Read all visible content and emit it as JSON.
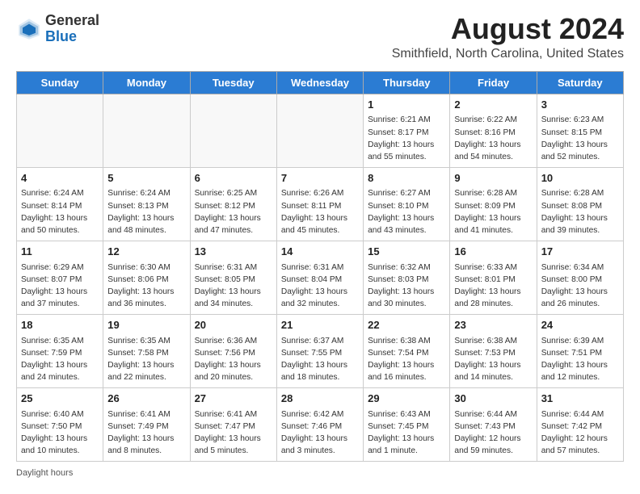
{
  "logo": {
    "general": "General",
    "blue": "Blue"
  },
  "title": "August 2024",
  "location": "Smithfield, North Carolina, United States",
  "headers": [
    "Sunday",
    "Monday",
    "Tuesday",
    "Wednesday",
    "Thursday",
    "Friday",
    "Saturday"
  ],
  "footer": "Daylight hours",
  "weeks": [
    [
      {
        "day": "",
        "sunrise": "",
        "sunset": "",
        "daylight": ""
      },
      {
        "day": "",
        "sunrise": "",
        "sunset": "",
        "daylight": ""
      },
      {
        "day": "",
        "sunrise": "",
        "sunset": "",
        "daylight": ""
      },
      {
        "day": "",
        "sunrise": "",
        "sunset": "",
        "daylight": ""
      },
      {
        "day": "1",
        "sunrise": "Sunrise: 6:21 AM",
        "sunset": "Sunset: 8:17 PM",
        "daylight": "Daylight: 13 hours and 55 minutes."
      },
      {
        "day": "2",
        "sunrise": "Sunrise: 6:22 AM",
        "sunset": "Sunset: 8:16 PM",
        "daylight": "Daylight: 13 hours and 54 minutes."
      },
      {
        "day": "3",
        "sunrise": "Sunrise: 6:23 AM",
        "sunset": "Sunset: 8:15 PM",
        "daylight": "Daylight: 13 hours and 52 minutes."
      }
    ],
    [
      {
        "day": "4",
        "sunrise": "Sunrise: 6:24 AM",
        "sunset": "Sunset: 8:14 PM",
        "daylight": "Daylight: 13 hours and 50 minutes."
      },
      {
        "day": "5",
        "sunrise": "Sunrise: 6:24 AM",
        "sunset": "Sunset: 8:13 PM",
        "daylight": "Daylight: 13 hours and 48 minutes."
      },
      {
        "day": "6",
        "sunrise": "Sunrise: 6:25 AM",
        "sunset": "Sunset: 8:12 PM",
        "daylight": "Daylight: 13 hours and 47 minutes."
      },
      {
        "day": "7",
        "sunrise": "Sunrise: 6:26 AM",
        "sunset": "Sunset: 8:11 PM",
        "daylight": "Daylight: 13 hours and 45 minutes."
      },
      {
        "day": "8",
        "sunrise": "Sunrise: 6:27 AM",
        "sunset": "Sunset: 8:10 PM",
        "daylight": "Daylight: 13 hours and 43 minutes."
      },
      {
        "day": "9",
        "sunrise": "Sunrise: 6:28 AM",
        "sunset": "Sunset: 8:09 PM",
        "daylight": "Daylight: 13 hours and 41 minutes."
      },
      {
        "day": "10",
        "sunrise": "Sunrise: 6:28 AM",
        "sunset": "Sunset: 8:08 PM",
        "daylight": "Daylight: 13 hours and 39 minutes."
      }
    ],
    [
      {
        "day": "11",
        "sunrise": "Sunrise: 6:29 AM",
        "sunset": "Sunset: 8:07 PM",
        "daylight": "Daylight: 13 hours and 37 minutes."
      },
      {
        "day": "12",
        "sunrise": "Sunrise: 6:30 AM",
        "sunset": "Sunset: 8:06 PM",
        "daylight": "Daylight: 13 hours and 36 minutes."
      },
      {
        "day": "13",
        "sunrise": "Sunrise: 6:31 AM",
        "sunset": "Sunset: 8:05 PM",
        "daylight": "Daylight: 13 hours and 34 minutes."
      },
      {
        "day": "14",
        "sunrise": "Sunrise: 6:31 AM",
        "sunset": "Sunset: 8:04 PM",
        "daylight": "Daylight: 13 hours and 32 minutes."
      },
      {
        "day": "15",
        "sunrise": "Sunrise: 6:32 AM",
        "sunset": "Sunset: 8:03 PM",
        "daylight": "Daylight: 13 hours and 30 minutes."
      },
      {
        "day": "16",
        "sunrise": "Sunrise: 6:33 AM",
        "sunset": "Sunset: 8:01 PM",
        "daylight": "Daylight: 13 hours and 28 minutes."
      },
      {
        "day": "17",
        "sunrise": "Sunrise: 6:34 AM",
        "sunset": "Sunset: 8:00 PM",
        "daylight": "Daylight: 13 hours and 26 minutes."
      }
    ],
    [
      {
        "day": "18",
        "sunrise": "Sunrise: 6:35 AM",
        "sunset": "Sunset: 7:59 PM",
        "daylight": "Daylight: 13 hours and 24 minutes."
      },
      {
        "day": "19",
        "sunrise": "Sunrise: 6:35 AM",
        "sunset": "Sunset: 7:58 PM",
        "daylight": "Daylight: 13 hours and 22 minutes."
      },
      {
        "day": "20",
        "sunrise": "Sunrise: 6:36 AM",
        "sunset": "Sunset: 7:56 PM",
        "daylight": "Daylight: 13 hours and 20 minutes."
      },
      {
        "day": "21",
        "sunrise": "Sunrise: 6:37 AM",
        "sunset": "Sunset: 7:55 PM",
        "daylight": "Daylight: 13 hours and 18 minutes."
      },
      {
        "day": "22",
        "sunrise": "Sunrise: 6:38 AM",
        "sunset": "Sunset: 7:54 PM",
        "daylight": "Daylight: 13 hours and 16 minutes."
      },
      {
        "day": "23",
        "sunrise": "Sunrise: 6:38 AM",
        "sunset": "Sunset: 7:53 PM",
        "daylight": "Daylight: 13 hours and 14 minutes."
      },
      {
        "day": "24",
        "sunrise": "Sunrise: 6:39 AM",
        "sunset": "Sunset: 7:51 PM",
        "daylight": "Daylight: 13 hours and 12 minutes."
      }
    ],
    [
      {
        "day": "25",
        "sunrise": "Sunrise: 6:40 AM",
        "sunset": "Sunset: 7:50 PM",
        "daylight": "Daylight: 13 hours and 10 minutes."
      },
      {
        "day": "26",
        "sunrise": "Sunrise: 6:41 AM",
        "sunset": "Sunset: 7:49 PM",
        "daylight": "Daylight: 13 hours and 8 minutes."
      },
      {
        "day": "27",
        "sunrise": "Sunrise: 6:41 AM",
        "sunset": "Sunset: 7:47 PM",
        "daylight": "Daylight: 13 hours and 5 minutes."
      },
      {
        "day": "28",
        "sunrise": "Sunrise: 6:42 AM",
        "sunset": "Sunset: 7:46 PM",
        "daylight": "Daylight: 13 hours and 3 minutes."
      },
      {
        "day": "29",
        "sunrise": "Sunrise: 6:43 AM",
        "sunset": "Sunset: 7:45 PM",
        "daylight": "Daylight: 13 hours and 1 minute."
      },
      {
        "day": "30",
        "sunrise": "Sunrise: 6:44 AM",
        "sunset": "Sunset: 7:43 PM",
        "daylight": "Daylight: 12 hours and 59 minutes."
      },
      {
        "day": "31",
        "sunrise": "Sunrise: 6:44 AM",
        "sunset": "Sunset: 7:42 PM",
        "daylight": "Daylight: 12 hours and 57 minutes."
      }
    ]
  ]
}
